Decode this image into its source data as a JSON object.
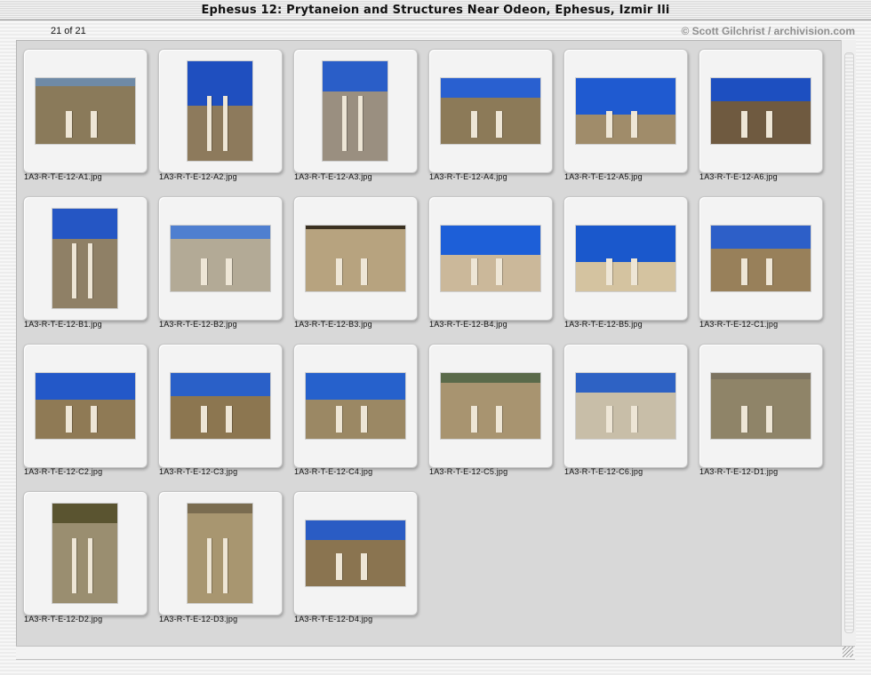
{
  "window": {
    "title": "Ephesus 12: Prytaneion and Structures Near Odeon, Ephesus, Izmir Ili"
  },
  "status": {
    "count": "21 of 21",
    "credit": "© Scott Gilchrist / archivision.com"
  },
  "photos": [
    {
      "file": "1A3-R-T-E-12-A1.jpg",
      "orient": "landscape",
      "sky": "12%",
      "skyc": "#6f8aa6",
      "ground": "#8a7a5a"
    },
    {
      "file": "1A3-R-T-E-12-A2.jpg",
      "orient": "portrait",
      "sky": "45%",
      "skyc": "#1f4fbf",
      "ground": "#8d7a5c"
    },
    {
      "file": "1A3-R-T-E-12-A3.jpg",
      "orient": "portrait",
      "sky": "30%",
      "skyc": "#2a5ec8",
      "ground": "#9a8f80"
    },
    {
      "file": "1A3-R-T-E-12-A4.jpg",
      "orient": "landscape",
      "sky": "30%",
      "skyc": "#2960d0",
      "ground": "#8c7a58"
    },
    {
      "file": "1A3-R-T-E-12-A5.jpg",
      "orient": "landscape",
      "sky": "55%",
      "skyc": "#1f5ad0",
      "ground": "#a08c6a"
    },
    {
      "file": "1A3-R-T-E-12-A6.jpg",
      "orient": "landscape",
      "sky": "35%",
      "skyc": "#1d4fc0",
      "ground": "#6f5a40"
    },
    {
      "file": "1A3-R-T-E-12-B1.jpg",
      "orient": "portrait",
      "sky": "30%",
      "skyc": "#2556c4",
      "ground": "#8f8066"
    },
    {
      "file": "1A3-R-T-E-12-B2.jpg",
      "orient": "landscape",
      "sky": "20%",
      "skyc": "#4f7fd0",
      "ground": "#b3aa96"
    },
    {
      "file": "1A3-R-T-E-12-B3.jpg",
      "orient": "landscape",
      "sky": "5%",
      "skyc": "#3a3020",
      "ground": "#b7a37f"
    },
    {
      "file": "1A3-R-T-E-12-B4.jpg",
      "orient": "landscape",
      "sky": "45%",
      "skyc": "#1d5fd8",
      "ground": "#cbb89a"
    },
    {
      "file": "1A3-R-T-E-12-B5.jpg",
      "orient": "landscape",
      "sky": "55%",
      "skyc": "#1a58cc",
      "ground": "#d4c3a0"
    },
    {
      "file": "1A3-R-T-E-12-C1.jpg",
      "orient": "landscape",
      "sky": "35%",
      "skyc": "#2d5fc8",
      "ground": "#98805a"
    },
    {
      "file": "1A3-R-T-E-12-C2.jpg",
      "orient": "landscape",
      "sky": "40%",
      "skyc": "#2358c8",
      "ground": "#8f7a55"
    },
    {
      "file": "1A3-R-T-E-12-C3.jpg",
      "orient": "landscape",
      "sky": "35%",
      "skyc": "#2a60c8",
      "ground": "#8c7650"
    },
    {
      "file": "1A3-R-T-E-12-C4.jpg",
      "orient": "landscape",
      "sky": "40%",
      "skyc": "#2661cc",
      "ground": "#9b8864"
    },
    {
      "file": "1A3-R-T-E-12-C5.jpg",
      "orient": "landscape",
      "sky": "15%",
      "skyc": "#5a6a4a",
      "ground": "#a89470"
    },
    {
      "file": "1A3-R-T-E-12-C6.jpg",
      "orient": "landscape",
      "sky": "30%",
      "skyc": "#2e62c4",
      "ground": "#c8bea8"
    },
    {
      "file": "1A3-R-T-E-12-D1.jpg",
      "orient": "landscape",
      "sky": "10%",
      "skyc": "#7c7360",
      "ground": "#8f8468"
    },
    {
      "file": "1A3-R-T-E-12-D2.jpg",
      "orient": "portrait",
      "sky": "20%",
      "skyc": "#5a5430",
      "ground": "#9a8e70"
    },
    {
      "file": "1A3-R-T-E-12-D3.jpg",
      "orient": "portrait",
      "sky": "10%",
      "skyc": "#7a6c50",
      "ground": "#a89670"
    },
    {
      "file": "1A3-R-T-E-12-D4.jpg",
      "orient": "landscape",
      "sky": "30%",
      "skyc": "#2a5cc4",
      "ground": "#8a7450"
    }
  ]
}
